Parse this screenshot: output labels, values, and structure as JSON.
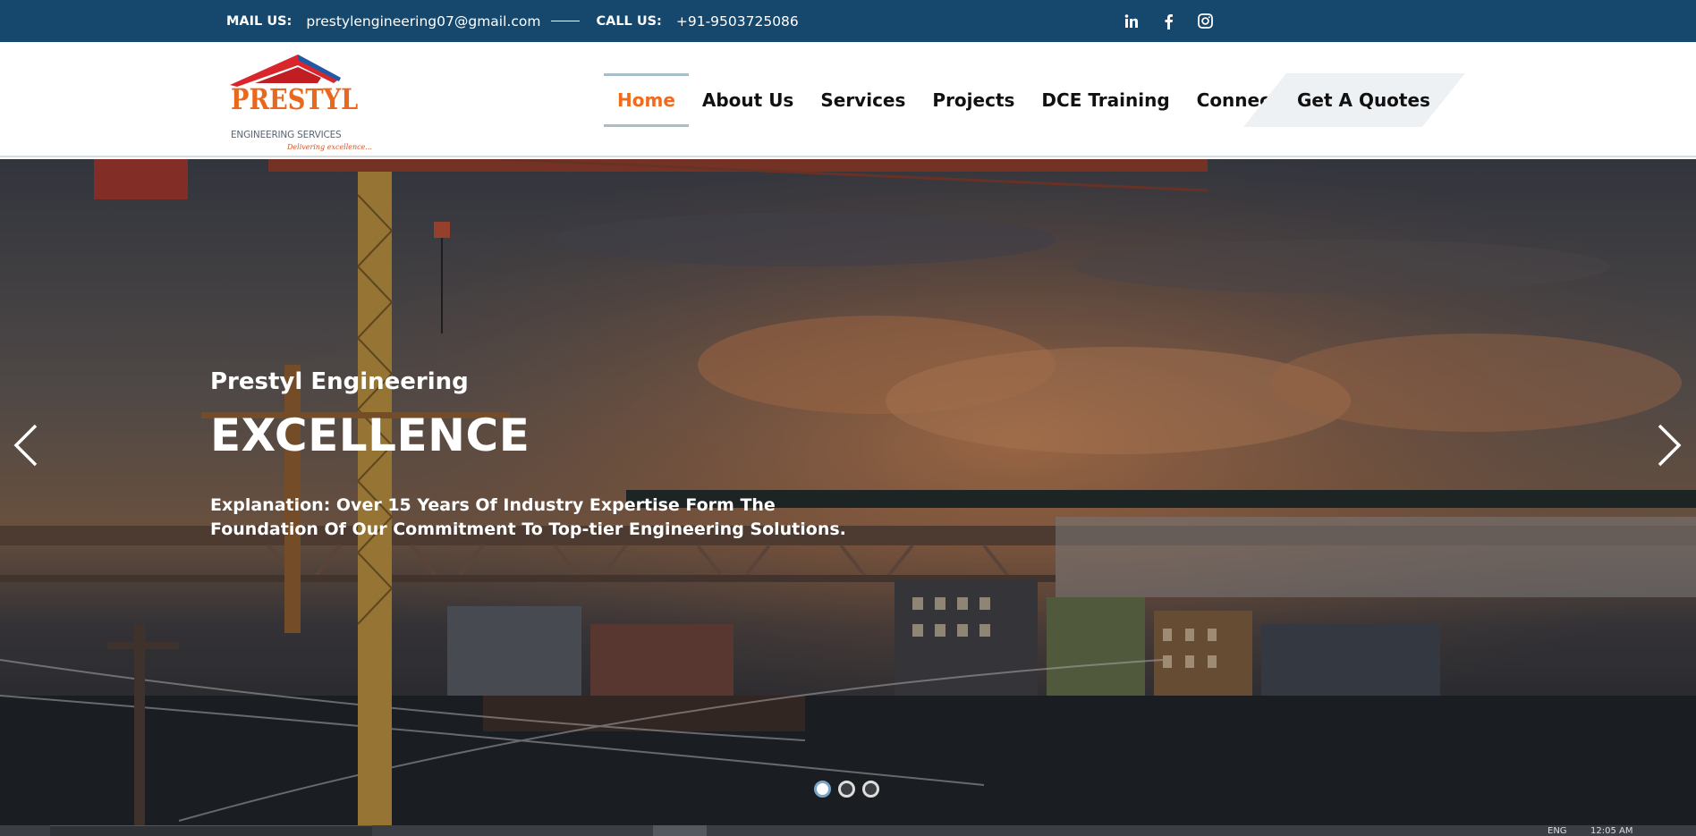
{
  "topbar": {
    "mail_label": "MAIL US:",
    "mail_value": "prestylengineering07@gmail.com",
    "call_label": "CALL US:",
    "call_value": "+91-9503725086",
    "socials": [
      {
        "icon": "linkedin-icon",
        "glyph": "in"
      },
      {
        "icon": "facebook-icon",
        "glyph": "f"
      },
      {
        "icon": "instagram-icon",
        "glyph": "◎"
      }
    ]
  },
  "logo": {
    "brand": "PRESTYL",
    "subtitle": "ENGINEERING SERVICES",
    "tagline": "Delivering excellence..."
  },
  "nav": {
    "items": [
      "Home",
      "About Us",
      "Services",
      "Projects",
      "DCE Training",
      "Connect"
    ],
    "active": "Home"
  },
  "cta": {
    "label": "Get A Quotes"
  },
  "hero": {
    "eyebrow": "Prestyl Engineering",
    "title": "EXCELLENCE",
    "description": "Explanation: Over 15 Years Of Industry Expertise Form The Foundation Of Our Commitment To Top-tier Engineering Solutions.",
    "slides_total": 3,
    "active_slide": 1
  },
  "taskbar": {
    "lang": "ENG",
    "time": "12:05 AM"
  },
  "colors": {
    "topbar_bg": "#15486c",
    "accent_orange": "#f26b1d",
    "nav_text": "#111111"
  }
}
